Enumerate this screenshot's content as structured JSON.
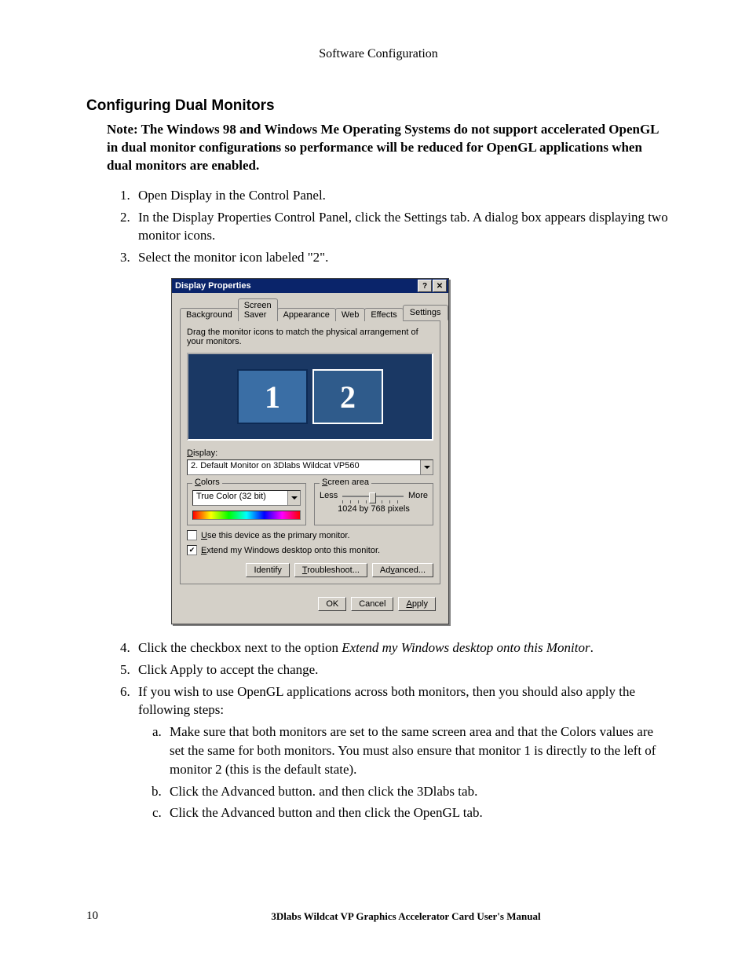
{
  "header": {
    "title": "Software Configuration"
  },
  "doc": {
    "heading": "Configuring Dual Monitors",
    "note": "Note: The Windows 98 and Windows Me Operating Systems do not support accelerated OpenGL in dual monitor configurations so performance will be reduced for OpenGL applications when dual monitors are enabled.",
    "steps_a": {
      "s1": "Open Display in the Control Panel.",
      "s2": "In the Display Properties Control Panel, click the Settings tab. A dialog box appears displaying two monitor icons.",
      "s3": "Select the monitor icon labeled \"2\"."
    },
    "steps_b": {
      "s4_pre": "Click the checkbox next to the option ",
      "s4_it": "Extend my Windows desktop onto this Monitor",
      "s4_post": ".",
      "s5": "Click Apply to accept the change.",
      "s6": "If you wish to use OpenGL applications across both monitors, then you should also apply the following steps:",
      "s6a": "Make sure that both monitors are set to the same screen area and that the Colors values are set the same for both monitors.  You must also ensure that  monitor 1 is directly to the left of monitor 2 (this is the default state).",
      "s6b": "Click the Advanced button. and then click the 3Dlabs tab.",
      "s6c": "Click the Advanced button and then click the OpenGL tab."
    }
  },
  "dialog": {
    "title": "Display Properties",
    "helpbtn": "?",
    "closebtn": "✕",
    "tabs": {
      "t1": "Background",
      "t2": "Screen Saver",
      "t3": "Appearance",
      "t4": "Web",
      "t5": "Effects",
      "t6": "Settings"
    },
    "instruction": "Drag the monitor icons to match the physical arrangement of your monitors.",
    "monitor1": "1",
    "monitor2": "2",
    "display_label": "Display:",
    "display_value": "2. Default Monitor on 3Dlabs Wildcat VP560",
    "colors_group": "Colors",
    "colors_value": "True Color (32 bit)",
    "area_group": "Screen area",
    "area_less": "Less",
    "area_more": "More",
    "area_value": "1024 by 768 pixels",
    "chk_primary": "Use this device as the primary monitor.",
    "chk_extend": "Extend my Windows desktop onto this monitor.",
    "btn_identify": "Identify",
    "btn_troubleshoot": "Troubleshoot...",
    "btn_advanced": "Advanced...",
    "btn_ok": "OK",
    "btn_cancel": "Cancel",
    "btn_apply": "Apply"
  },
  "footer": {
    "page": "10",
    "text": "3Dlabs Wildcat VP Graphics Accelerator Card User's Manual"
  }
}
